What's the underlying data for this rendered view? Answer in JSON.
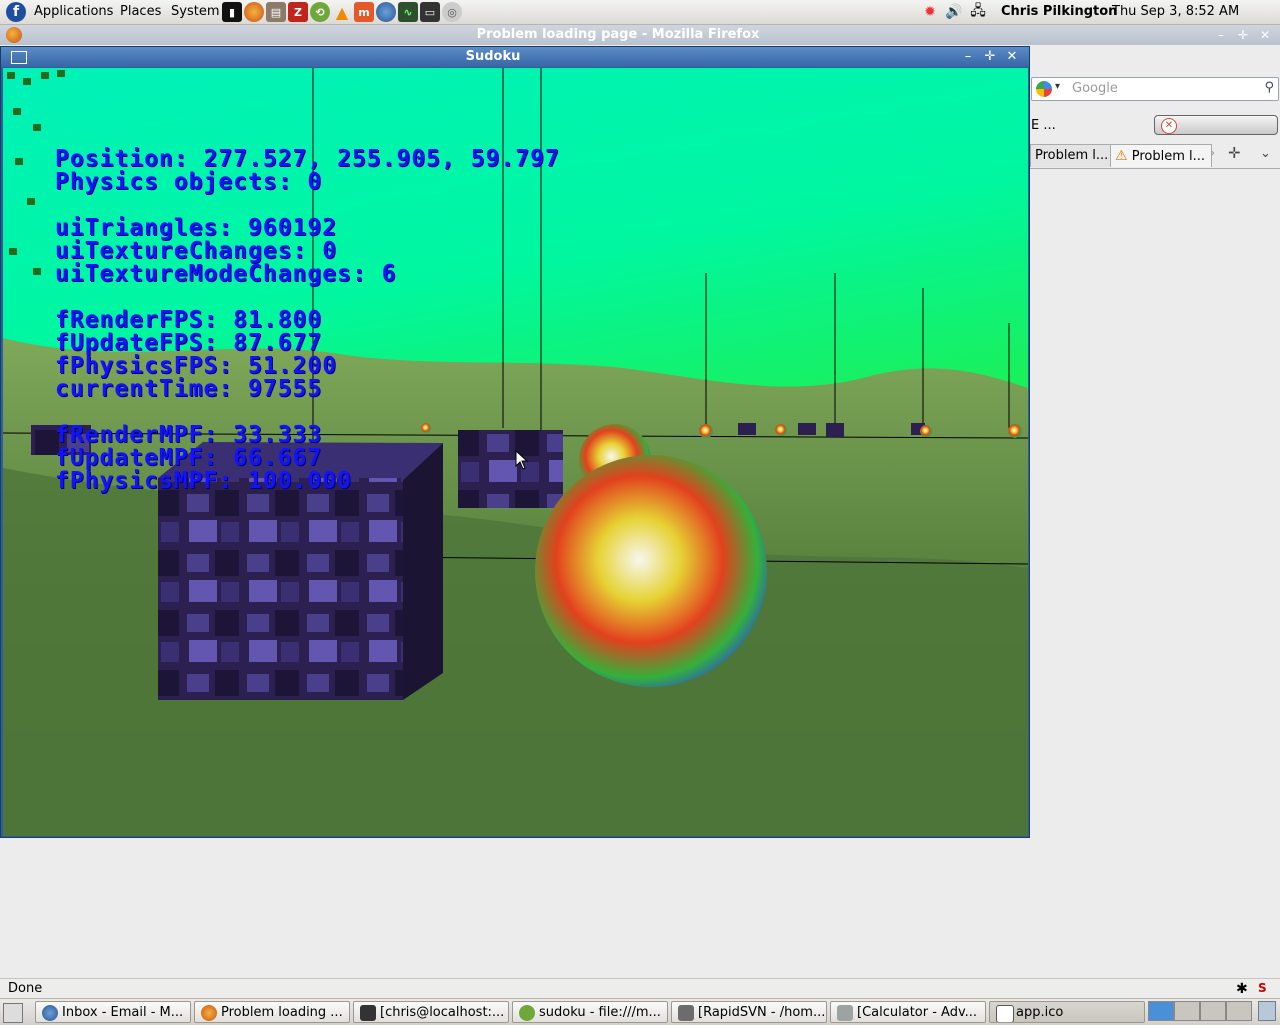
{
  "top_panel": {
    "menus": [
      "Applications",
      "Places",
      "System"
    ],
    "launchers": [
      "terminal",
      "firefox",
      "file-manager",
      "filezilla",
      "rapidsvn",
      "vlc",
      "mysql",
      "thunderbird",
      "system-monitor",
      "terminal-2",
      "gnome-disk"
    ],
    "user": "Chris Pilkington",
    "clock": "Thu Sep  3,  8:52 AM"
  },
  "firefox": {
    "title": "Problem loading page - Mozilla Firefox",
    "search_placeholder": "Google",
    "url_fragment": "E ...",
    "tabs": [
      "Problem l...",
      "Problem l..."
    ],
    "status": "Done"
  },
  "sudoku": {
    "title": "Sudoku",
    "stats": {
      "position": "Position: 277.527, 255.905, 59.797",
      "physics": "Physics objects: 0",
      "triangles": "uiTriangles: 960192",
      "texture_changes": "uiTextureChanges: 0",
      "texture_mode_changes": "uiTextureModeChanges: 6",
      "render_fps": "fRenderFPS: 81.800",
      "update_fps": "fUpdateFPS: 87.677",
      "physics_fps": "fPhysicsFPS: 51.200",
      "current_time": "currentTime: 97555",
      "render_mpf": "fRenderMPF: 33.333",
      "update_mpf": "fUpdateMPF: 66.667",
      "physics_mpf": "fPhysicsMPF: 100.000"
    }
  },
  "taskbar": {
    "items": [
      {
        "label": "Inbox - Email - M...",
        "icon": "thunderbird-icon"
      },
      {
        "label": "Problem loading ...",
        "icon": "firefox-icon"
      },
      {
        "label": "[chris@localhost:...",
        "icon": "terminal-icon"
      },
      {
        "label": "sudoku - file:///m...",
        "icon": "rapidsvn-icon"
      },
      {
        "label": "[RapidSVN - /hom...",
        "icon": "rapidsvn-icon"
      },
      {
        "label": "[Calculator - Adv...",
        "icon": "calculator-icon"
      },
      {
        "label": "app.ico",
        "icon": "window-icon"
      }
    ]
  }
}
